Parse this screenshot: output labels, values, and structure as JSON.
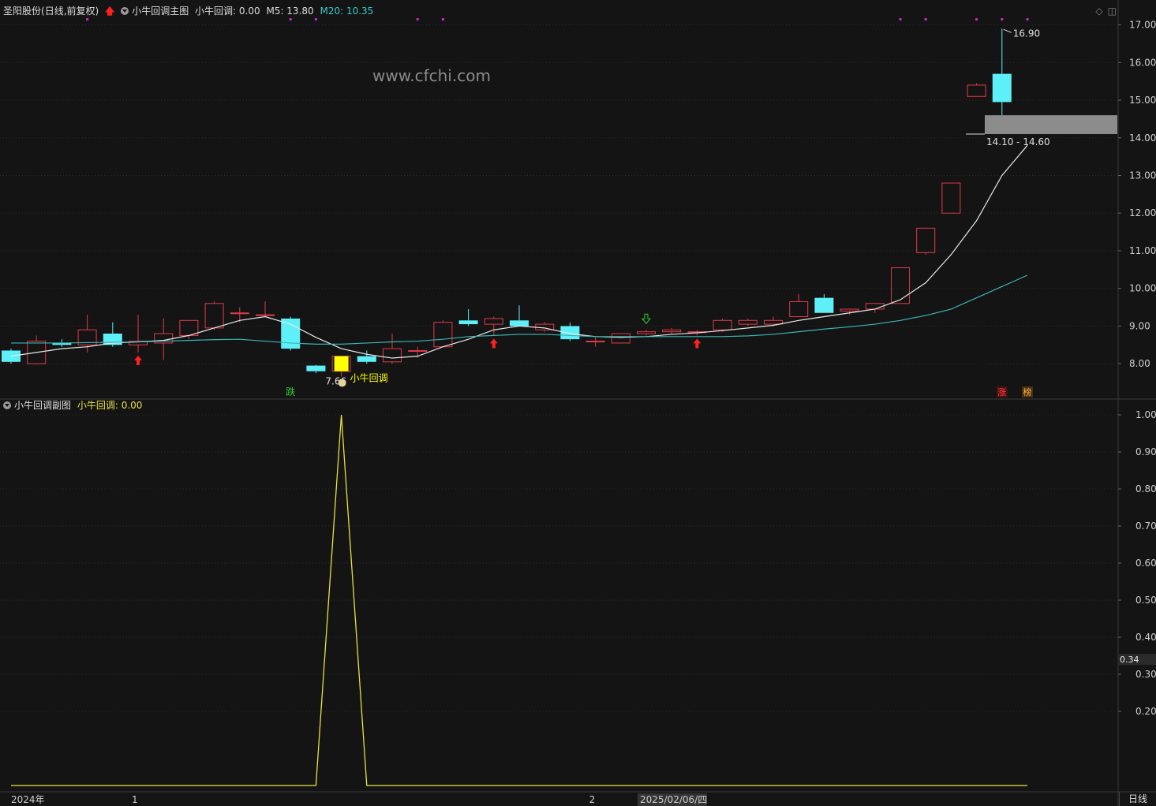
{
  "main_header": {
    "stock_name": "圣阳股份",
    "period": "(日线,前复权)",
    "indicator_name": "小牛回调主图",
    "ind_value": "小牛回调: 0.00",
    "m5": "M5: 13.80",
    "m20": "M20: 10.35"
  },
  "sub_header": {
    "indicator_name": "小牛回调副图",
    "ind_value": "小牛回调: 0.00"
  },
  "watermark": "www.cfchi.com",
  "bottom_tab": "日线",
  "annotations": {
    "high_price": "16.90",
    "low_price": "7.66",
    "signal_label": "小牛回调",
    "range_label": "14.10 - 14.60",
    "badge_die": "跌",
    "badge_zhang": "涨",
    "badge_bang": "榜",
    "current_sub_value": "0.34"
  },
  "colors": {
    "background": "#141414",
    "up_candle": "#e03a4a",
    "down_candle": "#5ef0f8",
    "ma5": "#e8e8e8",
    "ma20": "#3cb4b4",
    "indicator": "#e8e040",
    "signal_marker": "#ffff00",
    "dots": "#d020d0"
  },
  "chart_data": [
    {
      "type": "candlestick",
      "title": "小牛回调主图",
      "y_ticks": [
        "17.00",
        "16.00",
        "15.00",
        "14.00",
        "13.00",
        "12.00",
        "11.00",
        "10.00",
        "9.00",
        "8.00"
      ],
      "ylim": [
        7.25,
        17.2
      ],
      "x_labels": [
        {
          "i": 0,
          "text": "2024年"
        },
        {
          "i": 5,
          "text": "1"
        },
        {
          "i": 23,
          "text": "2"
        },
        {
          "i": 25,
          "text": "2025/02/06/四"
        }
      ],
      "candles": [
        {
          "o": 8.35,
          "h": 8.4,
          "l": 8.0,
          "c": 8.05
        },
        {
          "o": 8.0,
          "h": 8.75,
          "l": 7.98,
          "c": 8.6
        },
        {
          "o": 8.55,
          "h": 8.65,
          "l": 8.45,
          "c": 8.5
        },
        {
          "o": 8.5,
          "h": 9.3,
          "l": 8.3,
          "c": 8.9
        },
        {
          "o": 8.8,
          "h": 9.1,
          "l": 8.45,
          "c": 8.5
        },
        {
          "o": 8.5,
          "h": 9.3,
          "l": 8.3,
          "c": 8.6
        },
        {
          "o": 8.55,
          "h": 9.2,
          "l": 8.1,
          "c": 8.8
        },
        {
          "o": 8.75,
          "h": 9.15,
          "l": 8.65,
          "c": 9.15
        },
        {
          "o": 8.95,
          "h": 9.65,
          "l": 8.9,
          "c": 9.6
        },
        {
          "o": 9.35,
          "h": 9.5,
          "l": 9.1,
          "c": 9.35
        },
        {
          "o": 9.3,
          "h": 9.65,
          "l": 9.25,
          "c": 9.3
        },
        {
          "o": 9.2,
          "h": 9.25,
          "l": 8.35,
          "c": 8.4
        },
        {
          "o": 7.95,
          "h": 7.97,
          "l": 7.75,
          "c": 7.8
        },
        {
          "o": 7.8,
          "h": 8.2,
          "l": 7.66,
          "c": 8.2
        },
        {
          "o": 8.2,
          "h": 8.35,
          "l": 8.0,
          "c": 8.05
        },
        {
          "o": 8.05,
          "h": 8.8,
          "l": 8.0,
          "c": 8.4
        },
        {
          "o": 8.35,
          "h": 8.45,
          "l": 8.15,
          "c": 8.35
        },
        {
          "o": 8.45,
          "h": 9.15,
          "l": 8.45,
          "c": 9.1
        },
        {
          "o": 9.15,
          "h": 9.45,
          "l": 9.0,
          "c": 9.05
        },
        {
          "o": 9.05,
          "h": 9.25,
          "l": 8.75,
          "c": 9.2
        },
        {
          "o": 9.15,
          "h": 9.55,
          "l": 9.0,
          "c": 9.0
        },
        {
          "o": 8.9,
          "h": 9.1,
          "l": 8.85,
          "c": 9.05
        },
        {
          "o": 9.0,
          "h": 9.1,
          "l": 8.6,
          "c": 8.65
        },
        {
          "o": 8.6,
          "h": 8.7,
          "l": 8.45,
          "c": 8.6
        },
        {
          "o": 8.55,
          "h": 8.8,
          "l": 8.55,
          "c": 8.8
        },
        {
          "o": 8.8,
          "h": 8.9,
          "l": 8.75,
          "c": 8.85
        },
        {
          "o": 8.85,
          "h": 8.95,
          "l": 8.8,
          "c": 8.9
        },
        {
          "o": 8.85,
          "h": 8.9,
          "l": 8.75,
          "c": 8.85
        },
        {
          "o": 8.9,
          "h": 9.2,
          "l": 8.85,
          "c": 9.15
        },
        {
          "o": 9.05,
          "h": 9.2,
          "l": 9.0,
          "c": 9.15
        },
        {
          "o": 9.05,
          "h": 9.25,
          "l": 9.0,
          "c": 9.15
        },
        {
          "o": 9.25,
          "h": 9.85,
          "l": 9.25,
          "c": 9.65
        },
        {
          "o": 9.75,
          "h": 9.85,
          "l": 9.35,
          "c": 9.35
        },
        {
          "o": 9.4,
          "h": 9.45,
          "l": 9.3,
          "c": 9.45
        },
        {
          "o": 9.45,
          "h": 9.6,
          "l": 9.35,
          "c": 9.6
        },
        {
          "o": 9.6,
          "h": 10.55,
          "l": 9.6,
          "c": 10.55
        },
        {
          "o": 10.95,
          "h": 11.6,
          "l": 10.9,
          "c": 11.6
        },
        {
          "o": 12.0,
          "h": 12.8,
          "l": 12.0,
          "c": 12.8
        },
        {
          "o": 15.1,
          "h": 15.45,
          "l": 15.1,
          "c": 15.4
        },
        {
          "o": 15.7,
          "h": 16.9,
          "l": 14.6,
          "c": 14.95
        }
      ],
      "series": [
        {
          "name": "M5",
          "values": [
            8.2,
            8.3,
            8.4,
            8.45,
            8.55,
            8.58,
            8.62,
            8.75,
            8.95,
            9.15,
            9.25,
            9.05,
            8.7,
            8.4,
            8.25,
            8.15,
            8.2,
            8.45,
            8.65,
            8.9,
            9.0,
            8.95,
            8.8,
            8.72,
            8.7,
            8.72,
            8.78,
            8.82,
            8.88,
            8.95,
            9.02,
            9.15,
            9.25,
            9.35,
            9.45,
            9.7,
            10.15,
            10.9,
            11.8,
            13.0,
            13.8
          ]
        },
        {
          "name": "M20",
          "values": [
            8.55,
            8.55,
            8.55,
            8.56,
            8.57,
            8.58,
            8.6,
            8.62,
            8.64,
            8.65,
            8.6,
            8.55,
            8.52,
            8.52,
            8.55,
            8.58,
            8.6,
            8.65,
            8.72,
            8.75,
            8.78,
            8.78,
            8.75,
            8.72,
            8.72,
            8.72,
            8.72,
            8.72,
            8.72,
            8.74,
            8.78,
            8.85,
            8.92,
            8.98,
            9.05,
            9.15,
            9.28,
            9.45,
            9.75,
            10.05,
            10.35
          ]
        }
      ],
      "markers": {
        "up_arrows": [
          5,
          19,
          27
        ],
        "down_arrows": [
          25
        ],
        "signal_index": 13,
        "dots_top": [
          3,
          11,
          12,
          16,
          17,
          35,
          36,
          38,
          39,
          40
        ],
        "range_box": [
          14.1,
          14.6
        ]
      }
    },
    {
      "type": "line",
      "title": "小牛回调副图",
      "y_ticks": [
        "1.00",
        "0.90",
        "0.80",
        "0.70",
        "0.60",
        "0.50",
        "0.40",
        "0.30",
        "0.20"
      ],
      "ylim": [
        0,
        1.0
      ],
      "series": [
        {
          "name": "小牛回调",
          "values": [
            0,
            0,
            0,
            0,
            0,
            0,
            0,
            0,
            0,
            0,
            0,
            0,
            0,
            1,
            0,
            0,
            0,
            0,
            0,
            0,
            0,
            0,
            0,
            0,
            0,
            0,
            0,
            0,
            0,
            0,
            0,
            0,
            0,
            0,
            0,
            0,
            0,
            0,
            0,
            0,
            0
          ]
        }
      ]
    }
  ]
}
